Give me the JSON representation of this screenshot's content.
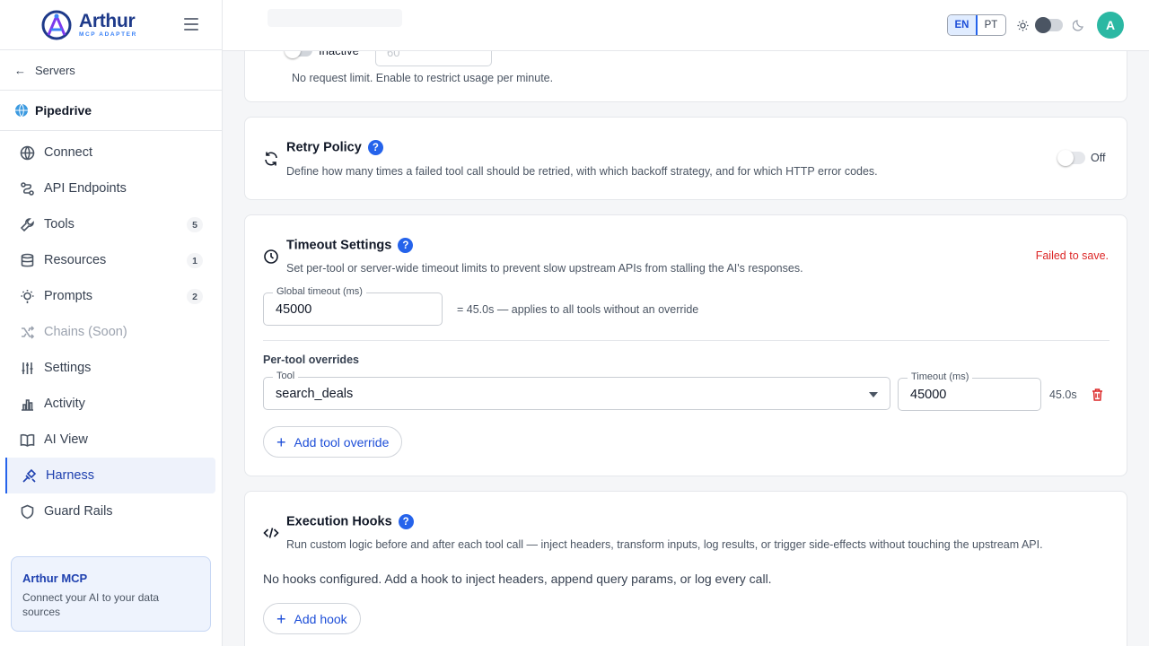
{
  "brand": {
    "name": "Arthur",
    "subtitle": "MCP ADAPTER"
  },
  "sidebar": {
    "back_label": "Servers",
    "server_name": "Pipedrive",
    "items": [
      {
        "label": "Connect",
        "icon": "globe-icon"
      },
      {
        "label": "API Endpoints",
        "icon": "api-icon"
      },
      {
        "label": "Tools",
        "icon": "wrench-icon",
        "badge": "5"
      },
      {
        "label": "Resources",
        "icon": "database-icon",
        "badge": "1"
      },
      {
        "label": "Prompts",
        "icon": "lightbulb-icon",
        "badge": "2"
      },
      {
        "label": "Chains (Soon)",
        "icon": "shuffle-icon",
        "disabled": true
      },
      {
        "label": "Settings",
        "icon": "sliders-icon"
      },
      {
        "label": "Activity",
        "icon": "bar-chart-icon"
      },
      {
        "label": "AI View",
        "icon": "book-icon"
      },
      {
        "label": "Harness",
        "icon": "harness-icon",
        "active": true
      },
      {
        "label": "Guard Rails",
        "icon": "shield-icon"
      }
    ],
    "promo": {
      "title": "Arthur MCP",
      "text": "Connect your AI to your data sources"
    }
  },
  "topbar": {
    "lang_en": "EN",
    "lang_pt": "PT",
    "avatar_initial": "A"
  },
  "rate_limit": {
    "status_label": "Inactive",
    "input_placeholder": "60",
    "hint": "No request limit. Enable to restrict usage per minute."
  },
  "retry_policy": {
    "title": "Retry Policy",
    "description": "Define how many times a failed tool call should be retried, with which backoff strategy, and for which HTTP error codes.",
    "toggle_label": "Off"
  },
  "timeout_settings": {
    "title": "Timeout Settings",
    "description": "Set per-tool or server-wide timeout limits to prevent slow upstream APIs from stalling the AI's responses.",
    "error": "Failed to save.",
    "global_label": "Global timeout (ms)",
    "global_value": "45000",
    "global_note": "= 45.0s — applies to all tools without an override",
    "overrides_label": "Per-tool overrides",
    "override": {
      "tool_label": "Tool",
      "tool_value": "search_deals",
      "timeout_label": "Timeout (ms)",
      "timeout_value": "45000",
      "seconds": "45.0s"
    },
    "add_override_label": "Add tool override"
  },
  "execution_hooks": {
    "title": "Execution Hooks",
    "description": "Run custom logic before and after each tool call — inject headers, transform inputs, log results, or trigger side-effects without touching the upstream API.",
    "empty_text": "No hooks configured. Add a hook to inject headers, append query params, or log every call.",
    "add_hook_label": "Add hook"
  },
  "colors": {
    "accent": "#2563eb",
    "avatar": "#2bb8a3",
    "error": "#dc2626",
    "active_bg": "#eef2fb"
  }
}
